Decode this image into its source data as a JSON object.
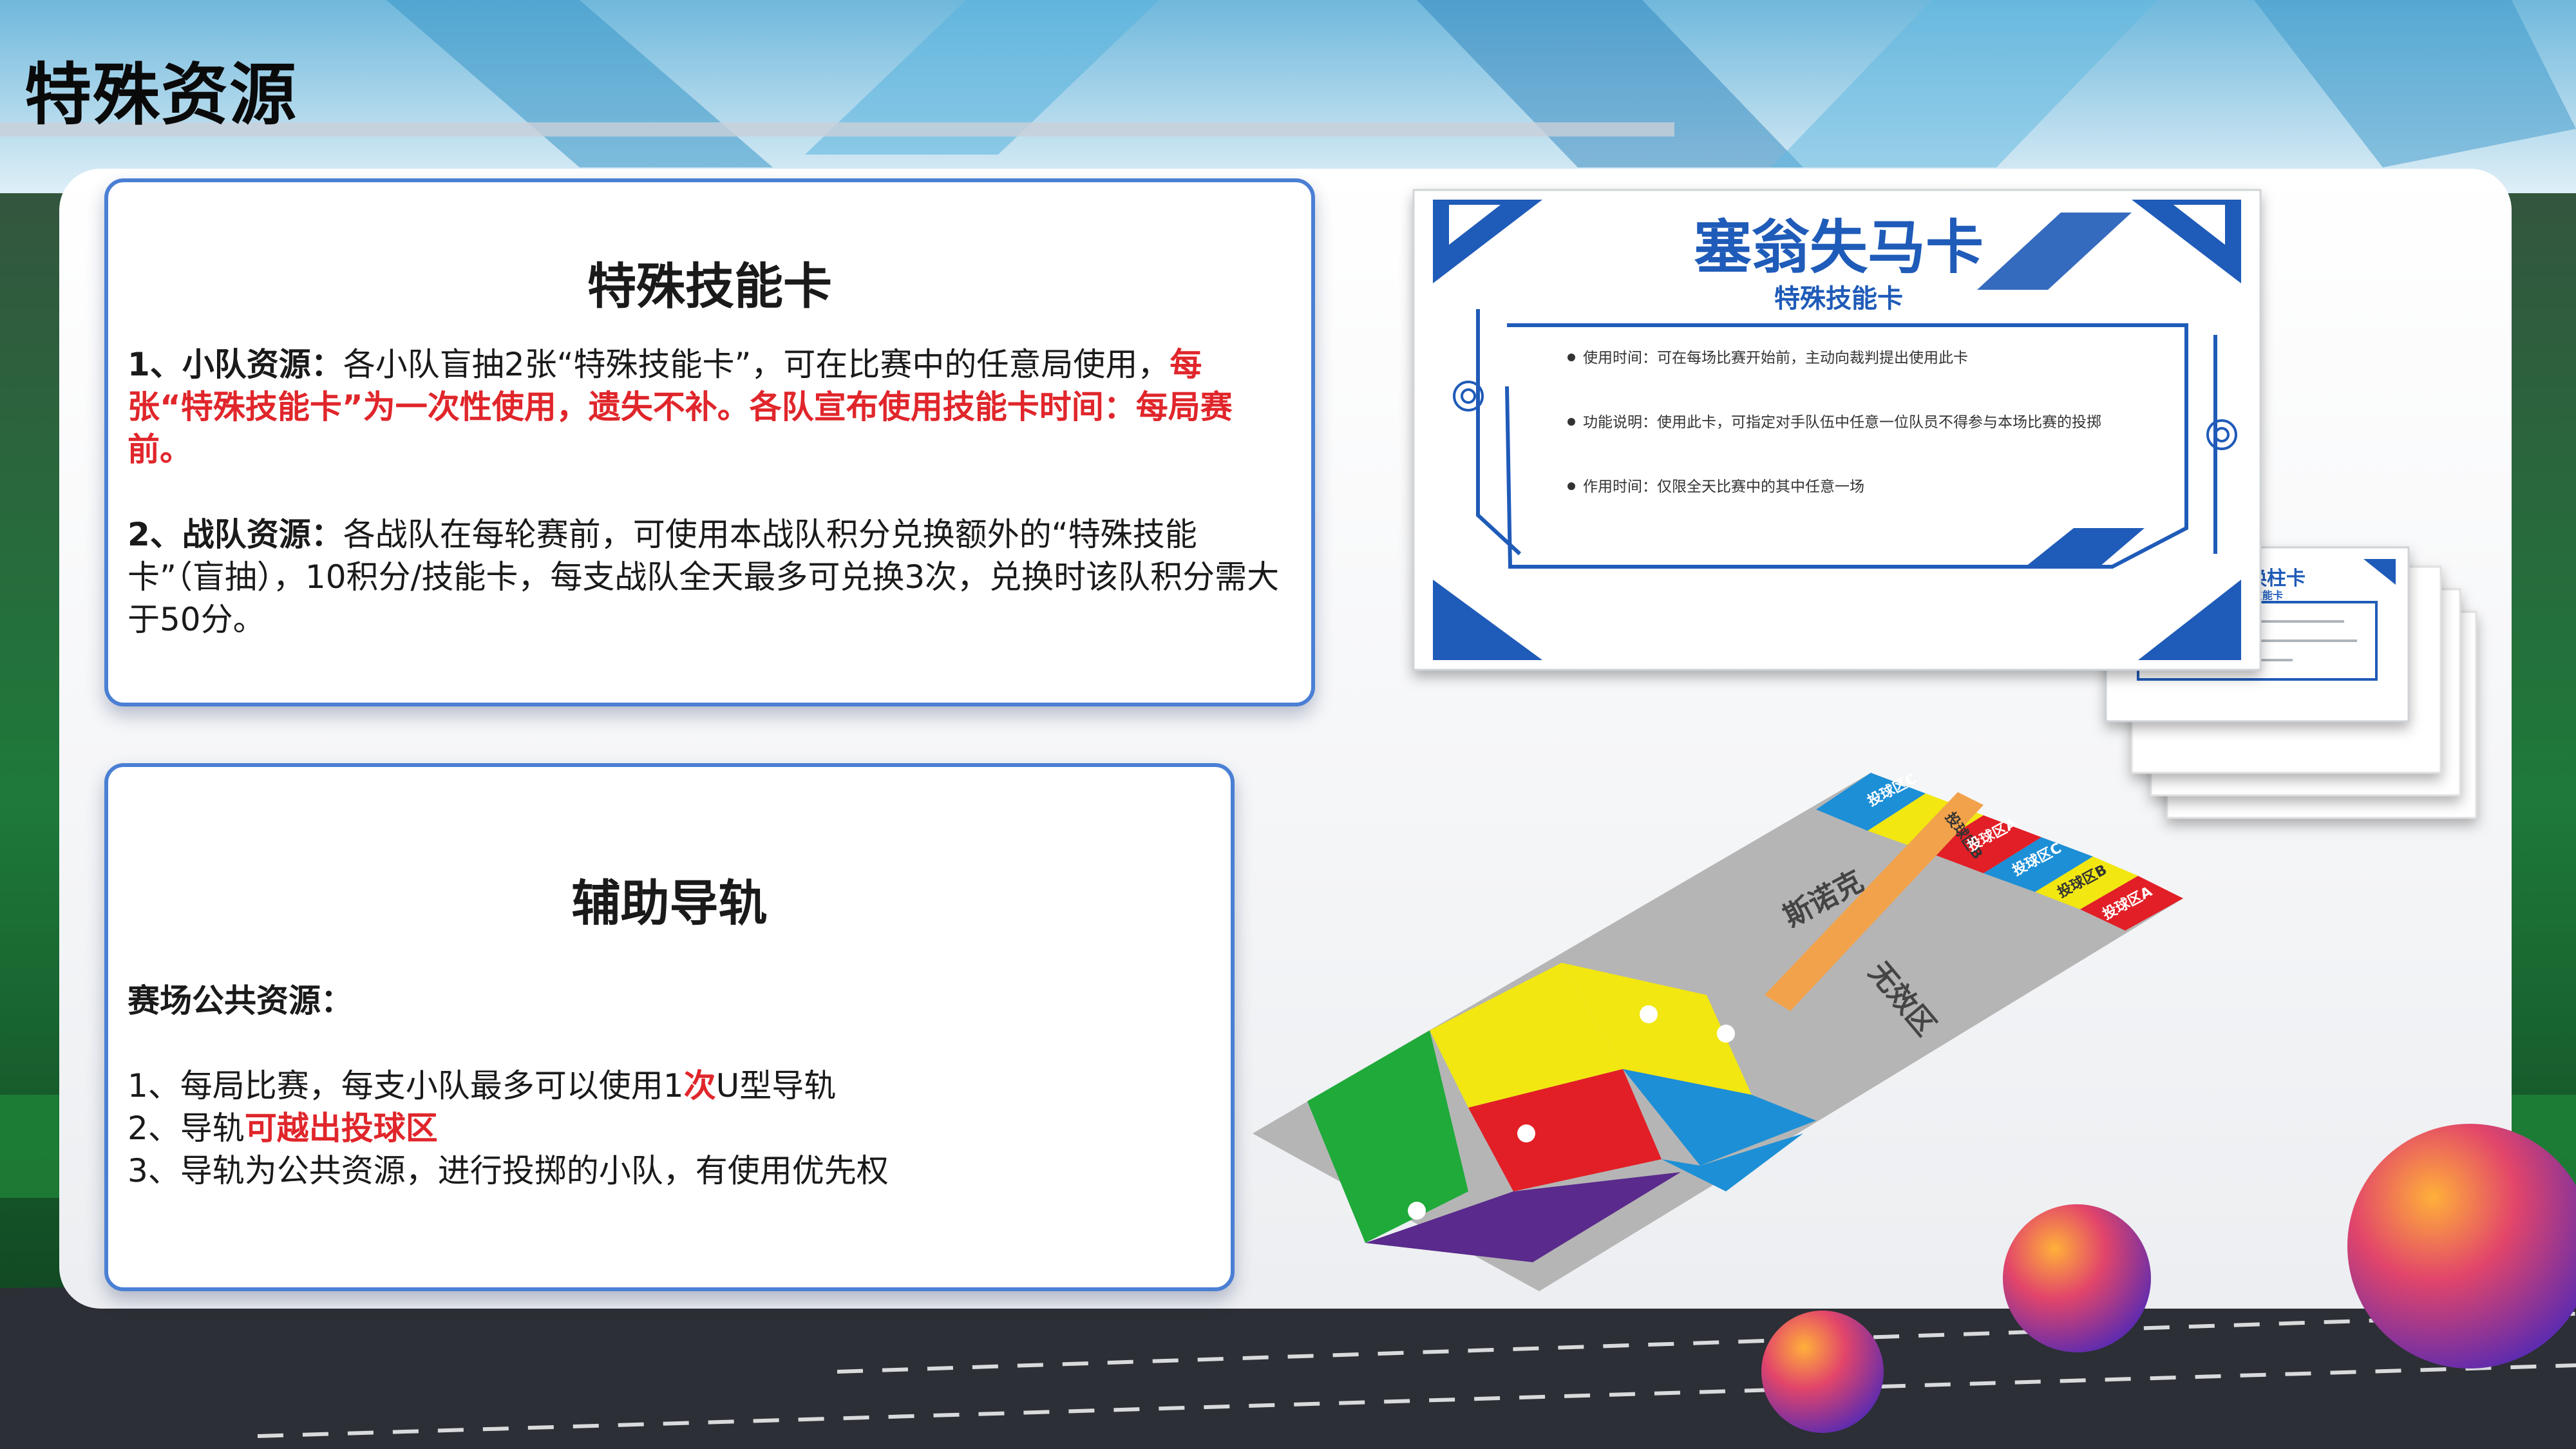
{
  "slide": {
    "title": "特殊资源"
  },
  "skill_card_section": {
    "title": "特殊技能卡",
    "item1": {
      "lead": "1、小队资源：",
      "text": "各小队盲抽2张“特殊技能卡”，可在比赛中的任意局使用，",
      "highlight": "每张“特殊技能卡”为一次性使用，遗失不补。各队宣布使用技能卡时间：每局赛前。"
    },
    "item2": {
      "lead": "2、战队资源：",
      "text": "各战队在每轮赛前，可使用本战队积分兑换额外的“特殊技能卡”（盲抽），10积分/技能卡，每支战队全天最多可兑换3次，兑换时该队积分需大于50分。"
    }
  },
  "guide_rail_section": {
    "title": "辅助导轨",
    "subtitle": "赛场公共资源：",
    "line1_a": "1、每局比赛，每支小队最多可以使用1",
    "line1_highlight": "次",
    "line1_b": "U型导轨",
    "line2_a": "2、导轨",
    "line2_highlight": "可越出投球区",
    "line3": "3、导轨为公共资源，进行投掷的小队，有使用优先权"
  },
  "skill_card_image": {
    "title": "塞翁失马卡",
    "subtitle": "特殊技能卡",
    "bullets": [
      "使用时间：可在每场比赛开始前，主动向裁判提出使用此卡",
      "功能说明：使用此卡，可指定对手队伍中任意一位队员不得参与本场比赛的投掷",
      "作用时间：仅限全天比赛中的其中任意一场"
    ]
  },
  "small_card_image": {
    "title": "偷梁换柱卡",
    "subtitle": "特殊技能卡"
  },
  "field_image": {
    "brand": "斯诺克",
    "neutral_zone": "无效区",
    "zone_labels": [
      "投球区C",
      "投球区B",
      "投球区A",
      "投球区C",
      "投球区B",
      "投球区A"
    ]
  },
  "colors": {
    "accent_red": "#e0262b",
    "card_border": "#4a7fd4",
    "card_blue": "#1f5bb8"
  }
}
